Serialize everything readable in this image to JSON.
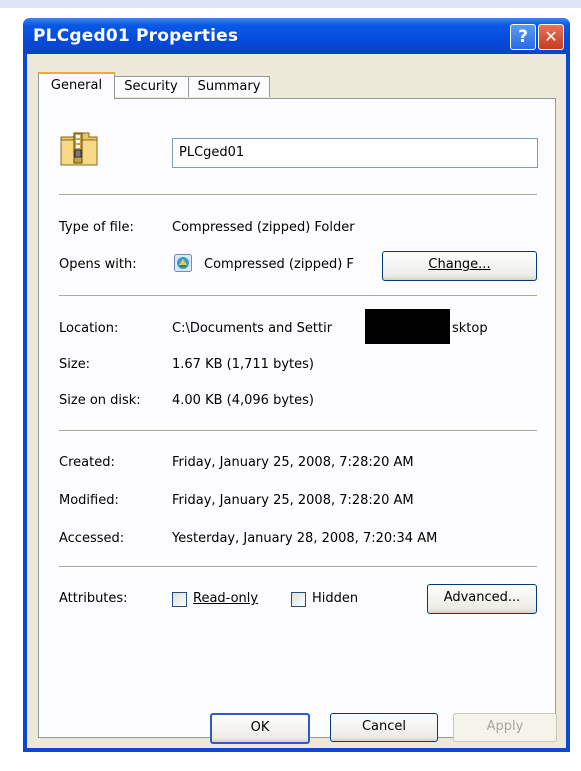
{
  "window": {
    "title": "PLCged01 Properties",
    "help_glyph": "?",
    "close_glyph": "✕"
  },
  "tabs": [
    {
      "label": "General",
      "active": true
    },
    {
      "label": "Security",
      "active": false
    },
    {
      "label": "Summary",
      "active": false
    }
  ],
  "general": {
    "name_value": "PLCged01",
    "type_label": "Type of file:",
    "type_value": "Compressed (zipped) Folder",
    "opens_label": "Opens with:",
    "opens_value": "Compressed (zipped) F",
    "change_button": "Change...",
    "location_label": "Location:",
    "location_value_start": "C:\\Documents and Settir",
    "location_value_end": "sktop",
    "size_label": "Size:",
    "size_value": "1.67 KB (1,711 bytes)",
    "size_disk_label": "Size on disk:",
    "size_disk_value": "4.00 KB (4,096 bytes)",
    "created_label": "Created:",
    "created_value": "Friday, January 25, 2008, 7:28:20 AM",
    "modified_label": "Modified:",
    "modified_value": "Friday, January 25, 2008, 7:28:20 AM",
    "accessed_label": "Accessed:",
    "accessed_value": "Yesterday, January 28, 2008, 7:20:34 AM",
    "attributes_label": "Attributes:",
    "readonly_label": "Read-only",
    "readonly_checked": false,
    "hidden_label": "Hidden",
    "hidden_checked": false,
    "advanced_button": "Advanced..."
  },
  "footer": {
    "ok": "OK",
    "cancel": "Cancel",
    "apply": "Apply"
  }
}
